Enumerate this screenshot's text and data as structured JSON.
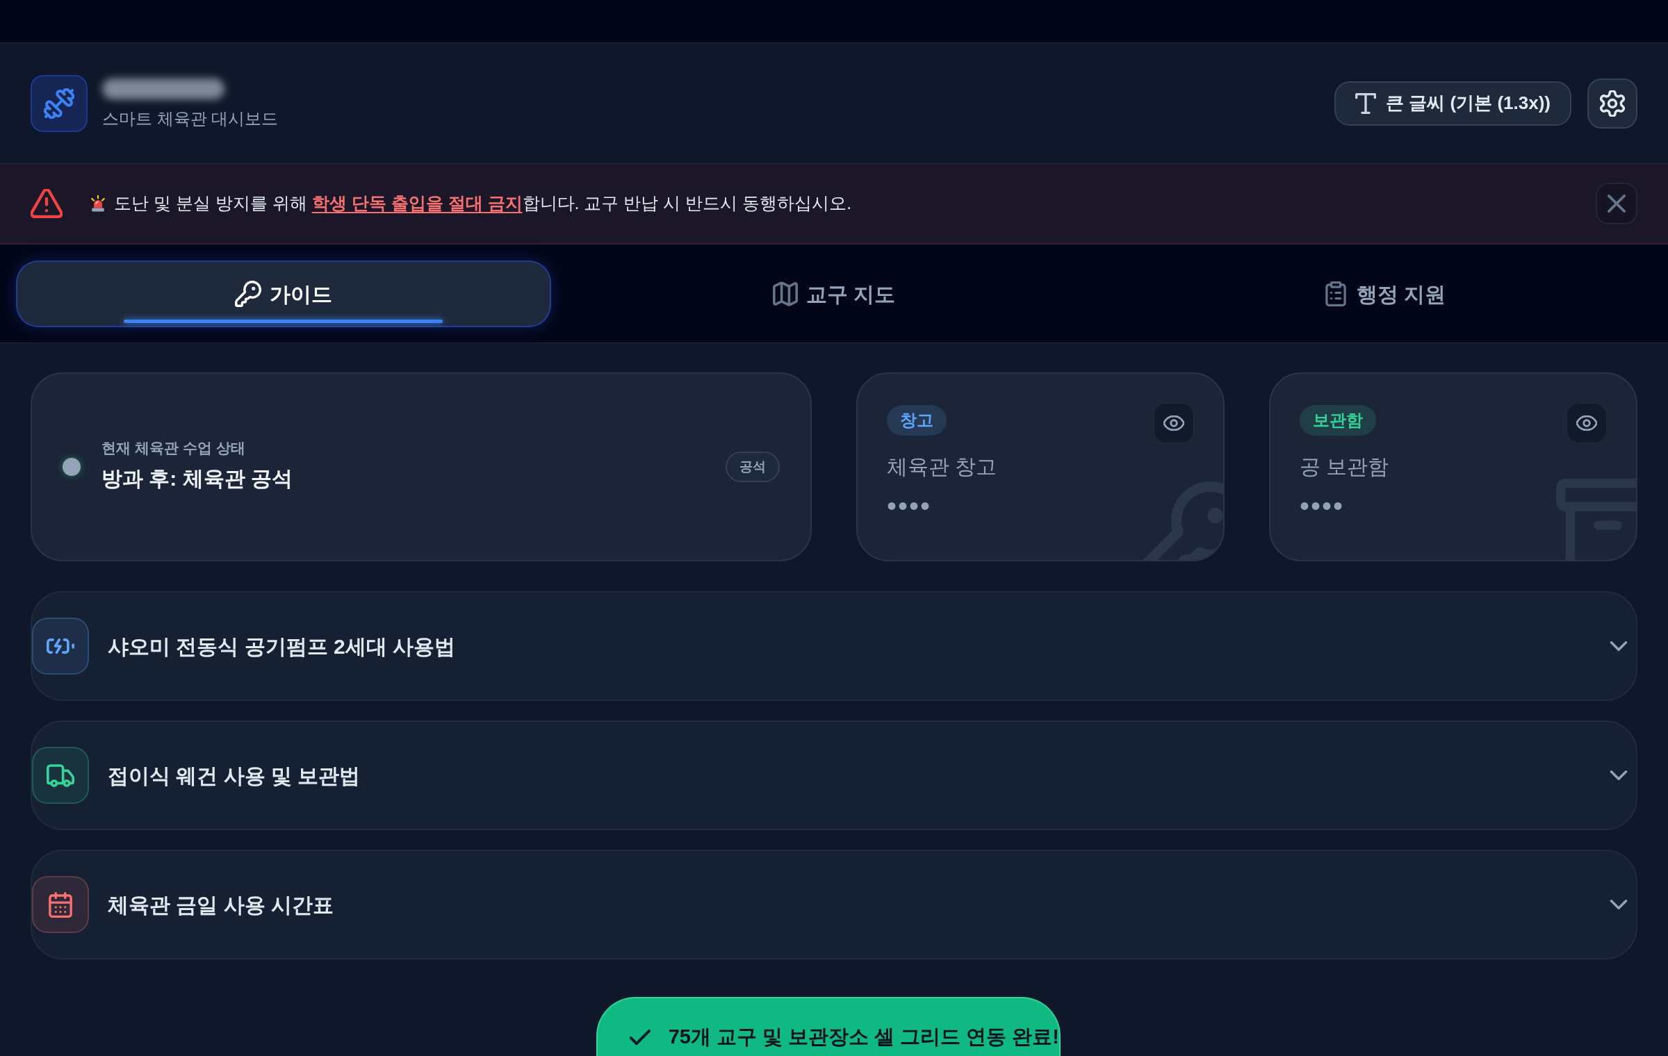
{
  "header": {
    "subtitle": "스마트 체육관 대시보드",
    "font_size_button": "큰 글씨 (기본 (1.3x))"
  },
  "alert": {
    "message": "도난 및 분실 방지를 위해 **학생 단독 출입을 절대 금지**합니다. 교구 반납 시 반드시 동행하십시오."
  },
  "tabs": [
    {
      "label": "가이드",
      "selected": true
    },
    {
      "label": "교구 지도",
      "selected": false
    },
    {
      "label": "행정 지원",
      "selected": false
    }
  ],
  "status": {
    "label": "현재 체육관 수업 상태",
    "value": "방과 후: 체육관 공석",
    "badge": "공석"
  },
  "storage": [
    {
      "tag": "창고",
      "color": "#60a5fa",
      "name": "체육관 창고",
      "code": "••••"
    },
    {
      "tag": "보관함",
      "color": "#34d399",
      "name": "공 보관함",
      "code": "••••"
    }
  ],
  "guides": [
    {
      "title": "샤오미 전동식 공기펌프 2세대 사용법",
      "color": "#60a5fa",
      "expanded": false
    },
    {
      "title": "접이식 웨건 사용 및 보관법",
      "color": "#34d399",
      "expanded": false
    },
    {
      "title": "체육관 금일 사용 시간표",
      "color": "#f87171",
      "expanded": false
    }
  ],
  "toast": {
    "message": "75개 교구 및 보관장소 셀 그리드 연동 완료!"
  }
}
